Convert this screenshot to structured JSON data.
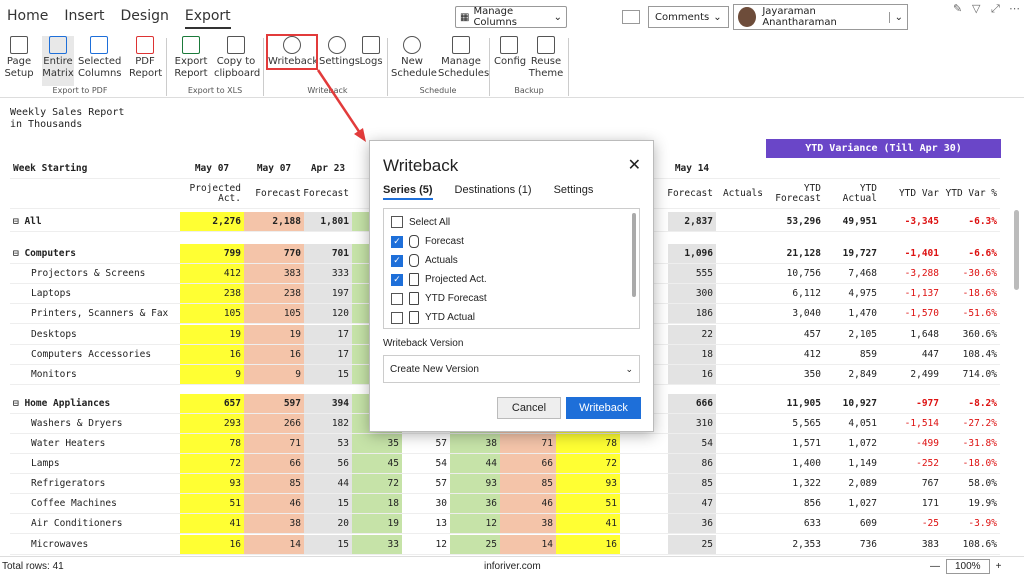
{
  "app": {
    "tabs": [
      "Home",
      "Insert",
      "Design",
      "Export"
    ],
    "active_tab": "Export",
    "manage_columns": "Manage Columns",
    "comments": "Comments",
    "user": "Jayaraman Anantharaman"
  },
  "ribbon": {
    "buttons": [
      {
        "label": "Page Setup"
      },
      {
        "label": "Entire Matrix"
      },
      {
        "label": "Selected Columns"
      },
      {
        "label": "PDF Report"
      },
      {
        "label": "Export Report"
      },
      {
        "label": "Copy to clipboard"
      },
      {
        "label": "Writeback"
      },
      {
        "label": "Settings"
      },
      {
        "label": "Logs"
      },
      {
        "label": "New Schedule"
      },
      {
        "label": "Manage Schedules"
      },
      {
        "label": "Config"
      },
      {
        "label": "Reuse Theme"
      }
    ],
    "groups": [
      "Export to PDF",
      "Export to XLS",
      "Writeback",
      "Schedule",
      "Backup"
    ]
  },
  "report": {
    "title": "Weekly Sales Report",
    "subtitle": "in Thousands"
  },
  "header": {
    "week": "Week Starting",
    "dates": [
      "May 07",
      "May 07",
      "Apr 23",
      "May 14"
    ],
    "cols": [
      "Projected Act.",
      "Forecast",
      "Forecast",
      "Forecast",
      "Actuals",
      "YTD Forecast",
      "YTD Actual",
      "YTD Var",
      "YTD Var %"
    ],
    "ytd_banner": "YTD Variance (Till Apr 30)"
  },
  "rows": [
    {
      "label": "⊟ All",
      "bold": true,
      "v": [
        "2,276",
        "2,188",
        "1,801",
        "",
        "",
        "",
        "",
        "",
        "2,837",
        "",
        "53,296",
        "49,951",
        "-3,345",
        "-6.3%"
      ]
    },
    {
      "label": "⊟ Computers",
      "bold": true,
      "v": [
        "799",
        "770",
        "701",
        "",
        "",
        "",
        "",
        "",
        "1,096",
        "",
        "21,128",
        "19,727",
        "-1,401",
        "-6.6%"
      ]
    },
    {
      "label": "Projectors & Screens",
      "v": [
        "412",
        "383",
        "333",
        "",
        "",
        "",
        "",
        "",
        "555",
        "",
        "10,756",
        "7,468",
        "-3,288",
        "-30.6%"
      ]
    },
    {
      "label": "Laptops",
      "v": [
        "238",
        "238",
        "197",
        "",
        "",
        "",
        "",
        "",
        "300",
        "",
        "6,112",
        "4,975",
        "-1,137",
        "-18.6%"
      ]
    },
    {
      "label": "Printers, Scanners & Fax",
      "v": [
        "105",
        "105",
        "120",
        "",
        "",
        "",
        "",
        "",
        "186",
        "",
        "3,040",
        "1,470",
        "-1,570",
        "-51.6%"
      ]
    },
    {
      "label": "Desktops",
      "v": [
        "19",
        "19",
        "17",
        "",
        "",
        "",
        "",
        "",
        "22",
        "",
        "457",
        "2,105",
        "1,648",
        "360.6%"
      ]
    },
    {
      "label": "Computers Accessories",
      "v": [
        "16",
        "16",
        "17",
        "",
        "",
        "",
        "",
        "",
        "18",
        "",
        "412",
        "859",
        "447",
        "108.4%"
      ]
    },
    {
      "label": "Monitors",
      "v": [
        "9",
        "9",
        "15",
        "",
        "",
        "",
        "",
        "",
        "16",
        "",
        "350",
        "2,849",
        "2,499",
        "714.0%"
      ]
    },
    {
      "label": "⊟ Home Appliances",
      "bold": true,
      "v": [
        "657",
        "597",
        "394",
        "",
        "",
        "",
        "",
        "",
        "666",
        "",
        "11,905",
        "10,927",
        "-977",
        "-8.2%"
      ]
    },
    {
      "label": "Washers & Dryers",
      "v": [
        "293",
        "266",
        "182",
        "",
        "",
        "",
        "",
        "",
        "310",
        "",
        "5,565",
        "4,051",
        "-1,514",
        "-27.2%"
      ]
    },
    {
      "label": "Water Heaters",
      "v": [
        "78",
        "71",
        "53",
        "35",
        "57",
        "38",
        "71",
        "78",
        "54",
        "",
        "1,571",
        "1,072",
        "-499",
        "-31.8%"
      ]
    },
    {
      "label": "Lamps",
      "v": [
        "72",
        "66",
        "56",
        "45",
        "54",
        "44",
        "66",
        "72",
        "86",
        "",
        "1,400",
        "1,149",
        "-252",
        "-18.0%"
      ]
    },
    {
      "label": "Refrigerators",
      "v": [
        "93",
        "85",
        "44",
        "72",
        "57",
        "93",
        "85",
        "93",
        "85",
        "",
        "1,322",
        "2,089",
        "767",
        "58.0%"
      ]
    },
    {
      "label": "Coffee Machines",
      "v": [
        "51",
        "46",
        "15",
        "18",
        "30",
        "36",
        "46",
        "51",
        "47",
        "",
        "856",
        "1,027",
        "171",
        "19.9%"
      ]
    },
    {
      "label": "Air Conditioners",
      "v": [
        "41",
        "38",
        "20",
        "19",
        "13",
        "12",
        "38",
        "41",
        "36",
        "",
        "633",
        "609",
        "-25",
        "-3.9%"
      ]
    },
    {
      "label": "Microwaves",
      "v": [
        "16",
        "14",
        "15",
        "33",
        "12",
        "25",
        "14",
        "16",
        "25",
        "",
        "2,353",
        "736",
        "383",
        "108.6%"
      ]
    }
  ],
  "dialog": {
    "title": "Writeback",
    "tabs": [
      "Series (5)",
      "Destinations (1)",
      "Settings"
    ],
    "items": [
      {
        "label": "Select All",
        "checked": false
      },
      {
        "label": "Forecast",
        "checked": true
      },
      {
        "label": "Actuals",
        "checked": true
      },
      {
        "label": "Projected Act.",
        "checked": true
      },
      {
        "label": "YTD Forecast",
        "checked": false
      },
      {
        "label": "YTD Actual",
        "checked": false
      }
    ],
    "version_label": "Writeback Version",
    "version_value": "Create New Version",
    "cancel": "Cancel",
    "ok": "Writeback"
  },
  "status": {
    "rows": "Total rows: 41",
    "brand": "inforiver.com",
    "zoom": "100%"
  },
  "colors": {
    "yellow": "#ffff33",
    "salmon": "#f4c4a9",
    "gray": "#e3e3e3",
    "green": "#c6e3a8",
    "purple": "#6a46c8",
    "blue": "#1e6fd9"
  }
}
